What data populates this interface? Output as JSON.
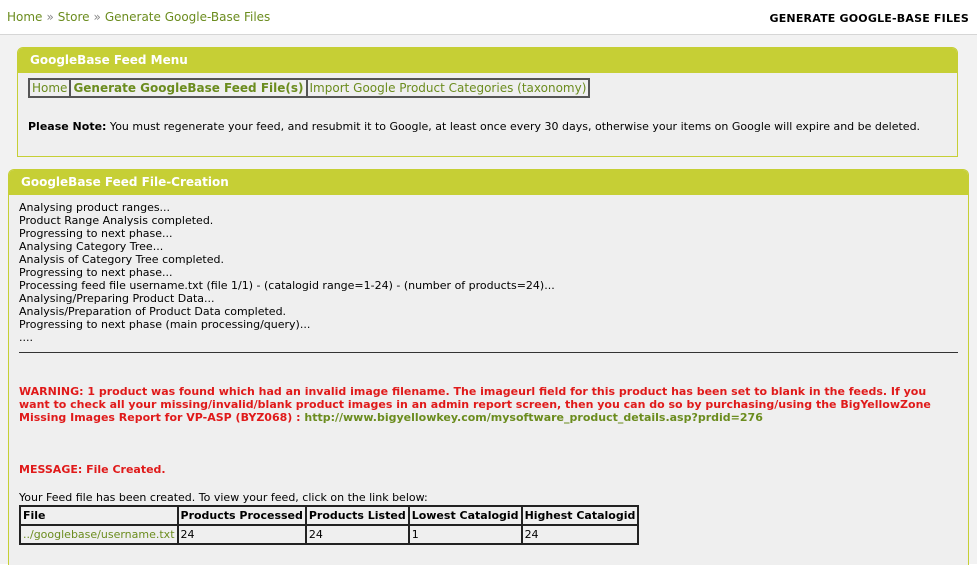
{
  "breadcrumb": {
    "items": [
      "Home",
      "Store",
      "Generate Google-Base Files"
    ],
    "separator": "»"
  },
  "page_title": "GENERATE GOOGLE-BASE FILES",
  "menu_panel": {
    "title": "GoogleBase Feed Menu",
    "nav": [
      {
        "label": "Home"
      },
      {
        "label": "Generate GoogleBase Feed File(s)"
      },
      {
        "label": "Import Google Product Categories (taxonomy)"
      }
    ],
    "note_label": "Please Note:",
    "note_text": " You must regenerate your feed, and resubmit it to Google, at least once every 30 days, otherwise your items on Google will expire and be deleted."
  },
  "creation_panel": {
    "title": "GoogleBase Feed File-Creation",
    "log": [
      "Analysing product ranges...",
      "Product Range Analysis completed.",
      "Progressing to next phase...",
      "Analysing Category Tree...",
      "Analysis of Category Tree completed.",
      "Progressing to next phase...",
      "Processing feed file username.txt (file 1/1) - (catalogid range=1-24) - (number of products=24)...",
      "Analysing/Preparing Product Data...",
      "Analysis/Preparation of Product Data completed.",
      "Progressing to next phase (main processing/query)...",
      "...."
    ],
    "warning_text": "WARNING: 1 product was found which had an invalid image filename. The imageurl field for this product has been set to blank in the feeds. If you want to check all your missing/invalid/blank product images in an admin report screen, then you can do so by purchasing/using the BigYellowZone Missing Images Report for VP-ASP (BYZ068) : ",
    "warning_link": "http://www.bigyellowkey.com/mysoftware_product_details.asp?prdid=276",
    "message": "MESSAGE: File Created.",
    "intro": "Your Feed file has been created. To view your feed, click on the link below:",
    "table": {
      "headers": [
        "File",
        "Products Processed",
        "Products Listed",
        "Lowest Catalogid",
        "Highest Catalogid"
      ],
      "rows": [
        [
          "../googlebase/username.txt",
          "24",
          "24",
          "1",
          "24"
        ]
      ]
    }
  },
  "colors": {
    "accent": "#c6cf35",
    "link": "#6b8c1e",
    "warning": "#e01a1a"
  }
}
